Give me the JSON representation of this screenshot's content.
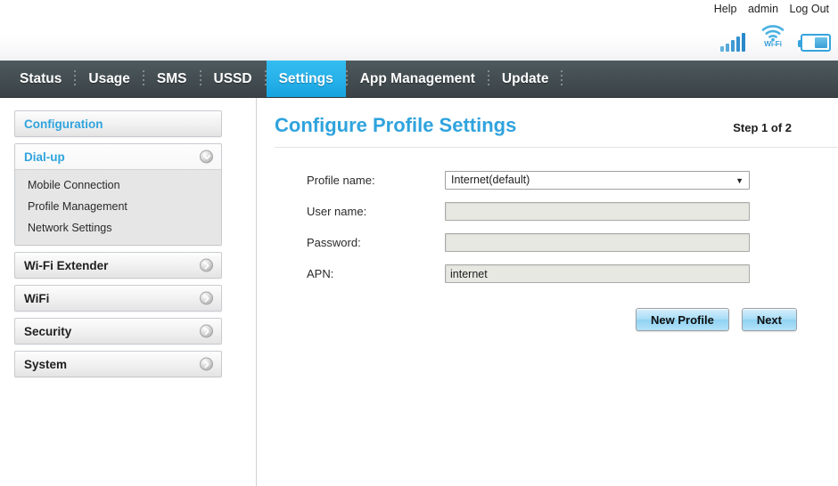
{
  "topbar": {
    "help_label": "Help",
    "user_label": "admin",
    "logout_label": "Log Out",
    "icons": {
      "signal": "signal-bars-icon",
      "wifi": "wifi-icon",
      "wifi_label": "Wi-Fi",
      "battery": "battery-icon"
    }
  },
  "nav": {
    "items": [
      {
        "label": "Status",
        "active": false
      },
      {
        "label": "Usage",
        "active": false
      },
      {
        "label": "SMS",
        "active": false
      },
      {
        "label": "USSD",
        "active": false
      },
      {
        "label": "Settings",
        "active": true
      },
      {
        "label": "App Management",
        "active": false
      },
      {
        "label": "Update",
        "active": false
      }
    ]
  },
  "sidebar": {
    "configuration_label": "Configuration",
    "groups": [
      {
        "label": "Dial-up",
        "expanded": true,
        "items": [
          "Mobile Connection",
          "Profile Management",
          "Network Settings"
        ]
      },
      {
        "label": "Wi-Fi Extender",
        "expanded": false,
        "items": []
      },
      {
        "label": "WiFi",
        "expanded": false,
        "items": []
      },
      {
        "label": "Security",
        "expanded": false,
        "items": []
      },
      {
        "label": "System",
        "expanded": false,
        "items": []
      }
    ]
  },
  "main": {
    "title": "Configure Profile Settings",
    "step": "Step 1 of 2",
    "form": {
      "profile_name": {
        "label": "Profile name:",
        "value": "Internet(default)",
        "arrow": "▼"
      },
      "user_name": {
        "label": "User name:",
        "value": "",
        "placeholder": ""
      },
      "password": {
        "label": "Password:",
        "value": "",
        "placeholder": ""
      },
      "apn": {
        "label": "APN:",
        "value": "internet",
        "placeholder": ""
      }
    },
    "buttons": {
      "new_profile": "New Profile",
      "next": "Next"
    }
  },
  "colors": {
    "accent_blue": "#2fa3dd",
    "nav_active": "#27b2ea",
    "nav_bg": "#454f53"
  }
}
